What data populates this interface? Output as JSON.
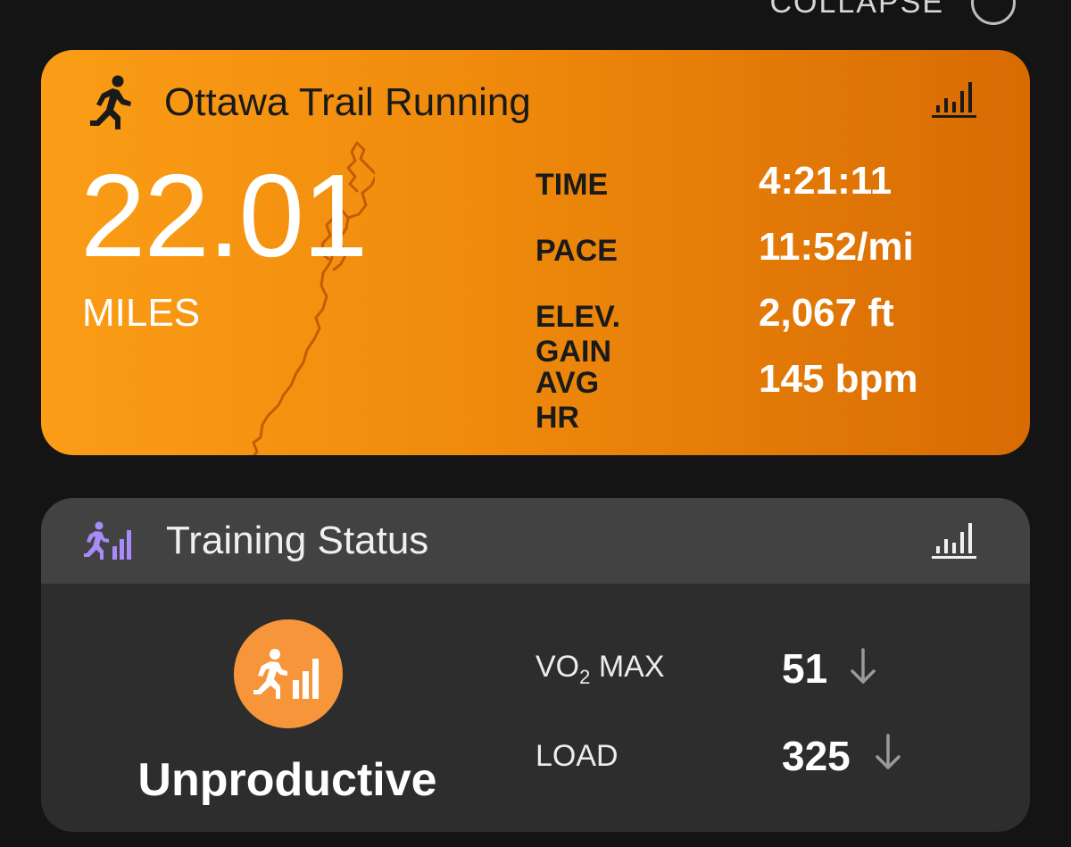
{
  "header": {
    "collapse_label": "COLLAPSE"
  },
  "activity": {
    "title": "Ottawa Trail Running",
    "distance": "22.01",
    "distance_unit": "MILES",
    "stats": [
      {
        "label": "TIME",
        "value": "4:21:11"
      },
      {
        "label": "PACE",
        "value": "11:52/mi"
      },
      {
        "label": "ELEV. GAIN",
        "value": "2,067 ft"
      },
      {
        "label": "AVG HR",
        "value": "145 bpm"
      }
    ],
    "colors": {
      "gradient_start": "#fb9d16",
      "gradient_end": "#d86b03"
    },
    "icons": {
      "activity": "runner-icon",
      "details": "bar-chart-icon"
    }
  },
  "training": {
    "title": "Training Status",
    "status": "Unproductive",
    "vo2_label_prefix": "VO",
    "vo2_label_sub": "2",
    "vo2_label_suffix": " MAX",
    "vo2_value": "51",
    "vo2_trend": "down",
    "load_label": "LOAD",
    "load_value": "325",
    "load_trend": "down",
    "colors": {
      "badge": "#f7953a",
      "header_icon": "#a78bfa"
    },
    "icons": {
      "header": "training-status-icon",
      "details": "bar-chart-icon",
      "trend": "arrow-down-icon"
    }
  }
}
